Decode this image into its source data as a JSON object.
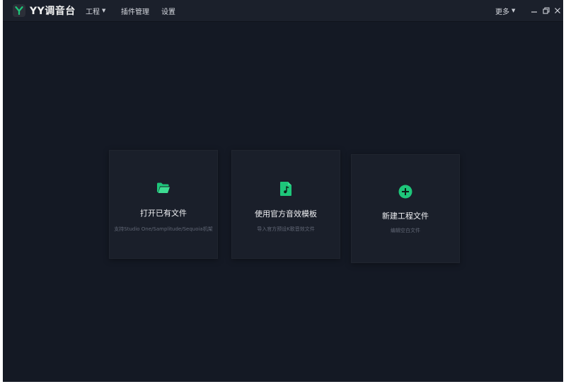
{
  "app": {
    "name": "YY调音台",
    "logo_letter": "Y"
  },
  "menu": {
    "project": "工程",
    "plugins": "插件管理",
    "settings": "设置",
    "more": "更多"
  },
  "colors": {
    "accent": "#1ec67a",
    "background": "#141924",
    "card": "#1a1f2a"
  },
  "cards": [
    {
      "icon": "folder-open-icon",
      "title": "打开已有文件",
      "subtitle": "支持Studio One/Samplitude/Sequoia机架"
    },
    {
      "icon": "music-file-icon",
      "title": "使用官方音效模板",
      "subtitle": "导入官方预设K歌音效文件"
    },
    {
      "icon": "plus-circle-icon",
      "title": "新建工程文件",
      "subtitle": "编辑空白文件"
    }
  ]
}
